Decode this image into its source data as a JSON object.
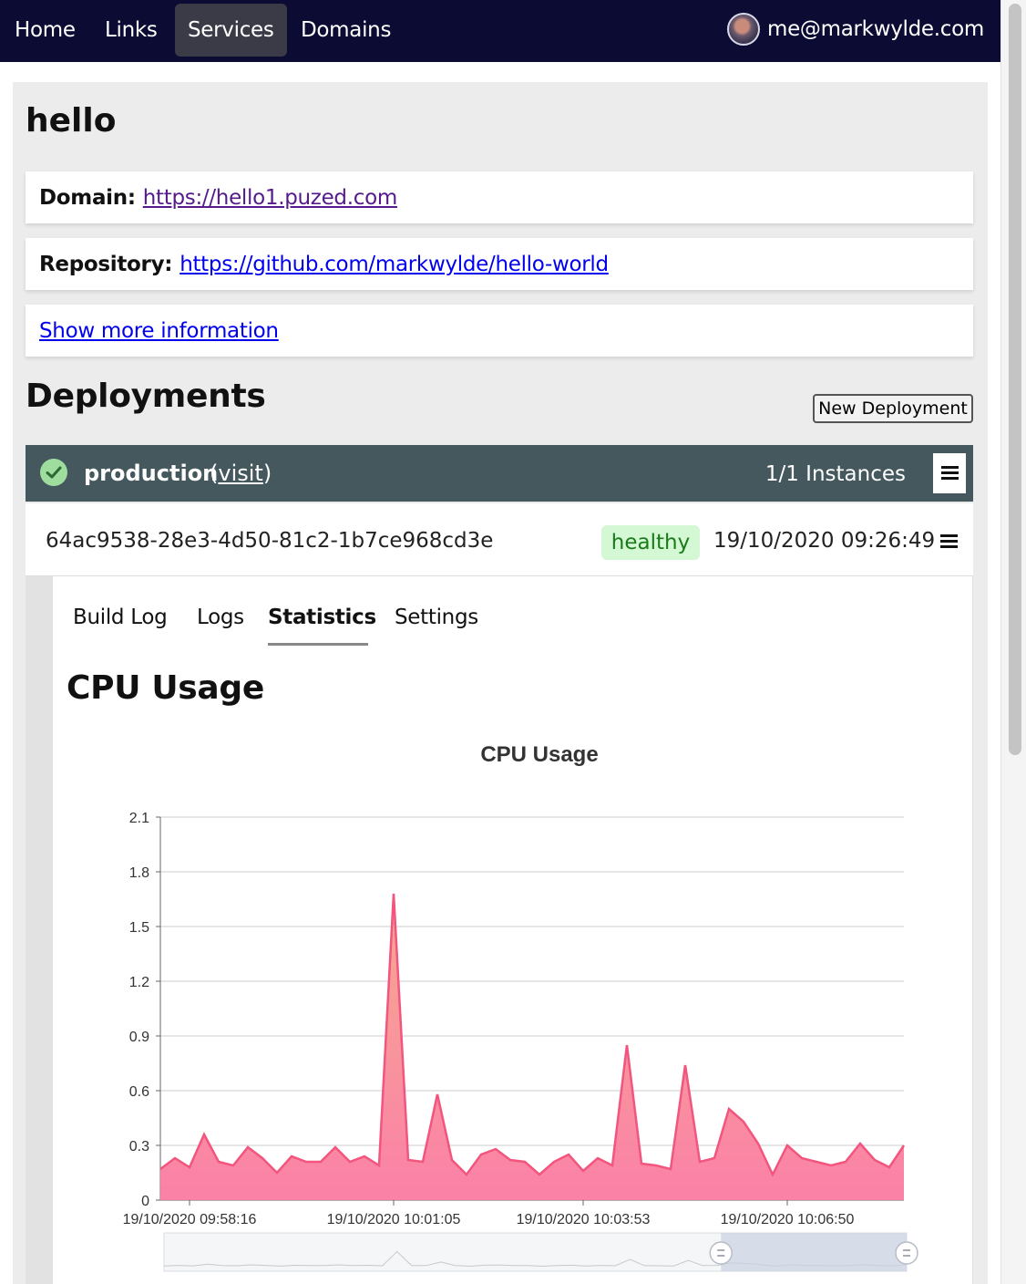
{
  "nav": {
    "items": [
      {
        "label": "Home"
      },
      {
        "label": "Links"
      },
      {
        "label": "Services"
      },
      {
        "label": "Domains"
      }
    ],
    "active": "Services",
    "user_email": "me@markwylde.com"
  },
  "service": {
    "name": "hello",
    "domain_label": "Domain:",
    "domain_url": "https://hello1.puzed.com",
    "repo_label": "Repository:",
    "repo_url": "https://github.com/markwylde/hello-world",
    "show_more": "Show more information"
  },
  "deployments": {
    "title": "Deployments",
    "new_button": "New Deployment",
    "env": {
      "name": "production",
      "visit_open": "(",
      "visit_label": "visit",
      "visit_close": ")",
      "instances": "1/1 Instances",
      "status_color": "#9fdd9f"
    },
    "instance": {
      "id": "64ac9538-28e3-4d50-81c2-1b7ce968cd3e",
      "status": "healthy",
      "date": "19/10/2020 09:26:49"
    },
    "tabs": [
      {
        "label": "Build Log"
      },
      {
        "label": "Logs"
      },
      {
        "label": "Statistics"
      },
      {
        "label": "Settings"
      }
    ],
    "active_tab": "Statistics",
    "section_heading": "CPU Usage"
  },
  "chart_data": {
    "type": "area",
    "title": "CPU Usage",
    "xlabel": "",
    "ylabel": "",
    "ylim": [
      0,
      2.1
    ],
    "yticks": [
      0,
      0.3,
      0.6,
      0.9,
      1.2,
      1.5,
      1.8,
      2.1
    ],
    "xtick_labels": [
      "19/10/2020 09:58:16",
      "19/10/2020 10:01:05",
      "19/10/2020 10:03:53",
      "19/10/2020 10:06:50"
    ],
    "grid": true,
    "series": [
      {
        "color": "#f2557d",
        "values": [
          0.17,
          0.23,
          0.18,
          0.36,
          0.21,
          0.19,
          0.29,
          0.23,
          0.15,
          0.24,
          0.21,
          0.21,
          0.29,
          0.21,
          0.24,
          0.19,
          1.68,
          0.22,
          0.21,
          0.58,
          0.22,
          0.14,
          0.25,
          0.28,
          0.22,
          0.21,
          0.14,
          0.21,
          0.25,
          0.16,
          0.23,
          0.19,
          0.85,
          0.2,
          0.19,
          0.17,
          0.74,
          0.21,
          0.23,
          0.5,
          0.43,
          0.31,
          0.14,
          0.3,
          0.23,
          0.21,
          0.19,
          0.21,
          0.31,
          0.22,
          0.18,
          0.3
        ]
      }
    ],
    "zoom_window": [
      0.75,
      1.0
    ]
  }
}
